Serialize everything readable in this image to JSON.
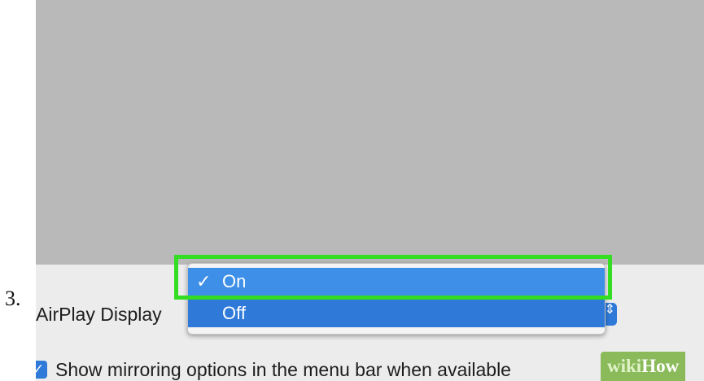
{
  "step": {
    "number": "3."
  },
  "panel": {
    "airplay_label": "AirPlay Display",
    "mirror_checkbox_label": "Show mirroring options in the menu bar when available",
    "mirror_checkbox_checked": true
  },
  "dropdown": {
    "selected": "On",
    "items": [
      {
        "label": "On",
        "checked": true
      },
      {
        "label": "Off",
        "checked": false
      }
    ],
    "check_glyph": "✓"
  },
  "watermark": {
    "wiki": "wiki",
    "how": "How"
  },
  "colors": {
    "highlight": "#33dd22",
    "menu_selection": "#3d8fe8",
    "menu_item": "#2f7ad9",
    "display_area": "#b9b9b9",
    "panel_background": "#ececec",
    "watermark_background": "#8aba5a"
  },
  "icons": {
    "checkmark": "checkmark-icon",
    "checkbox": "checkbox-checked-icon",
    "stepper": "popup-stepper-icon"
  }
}
